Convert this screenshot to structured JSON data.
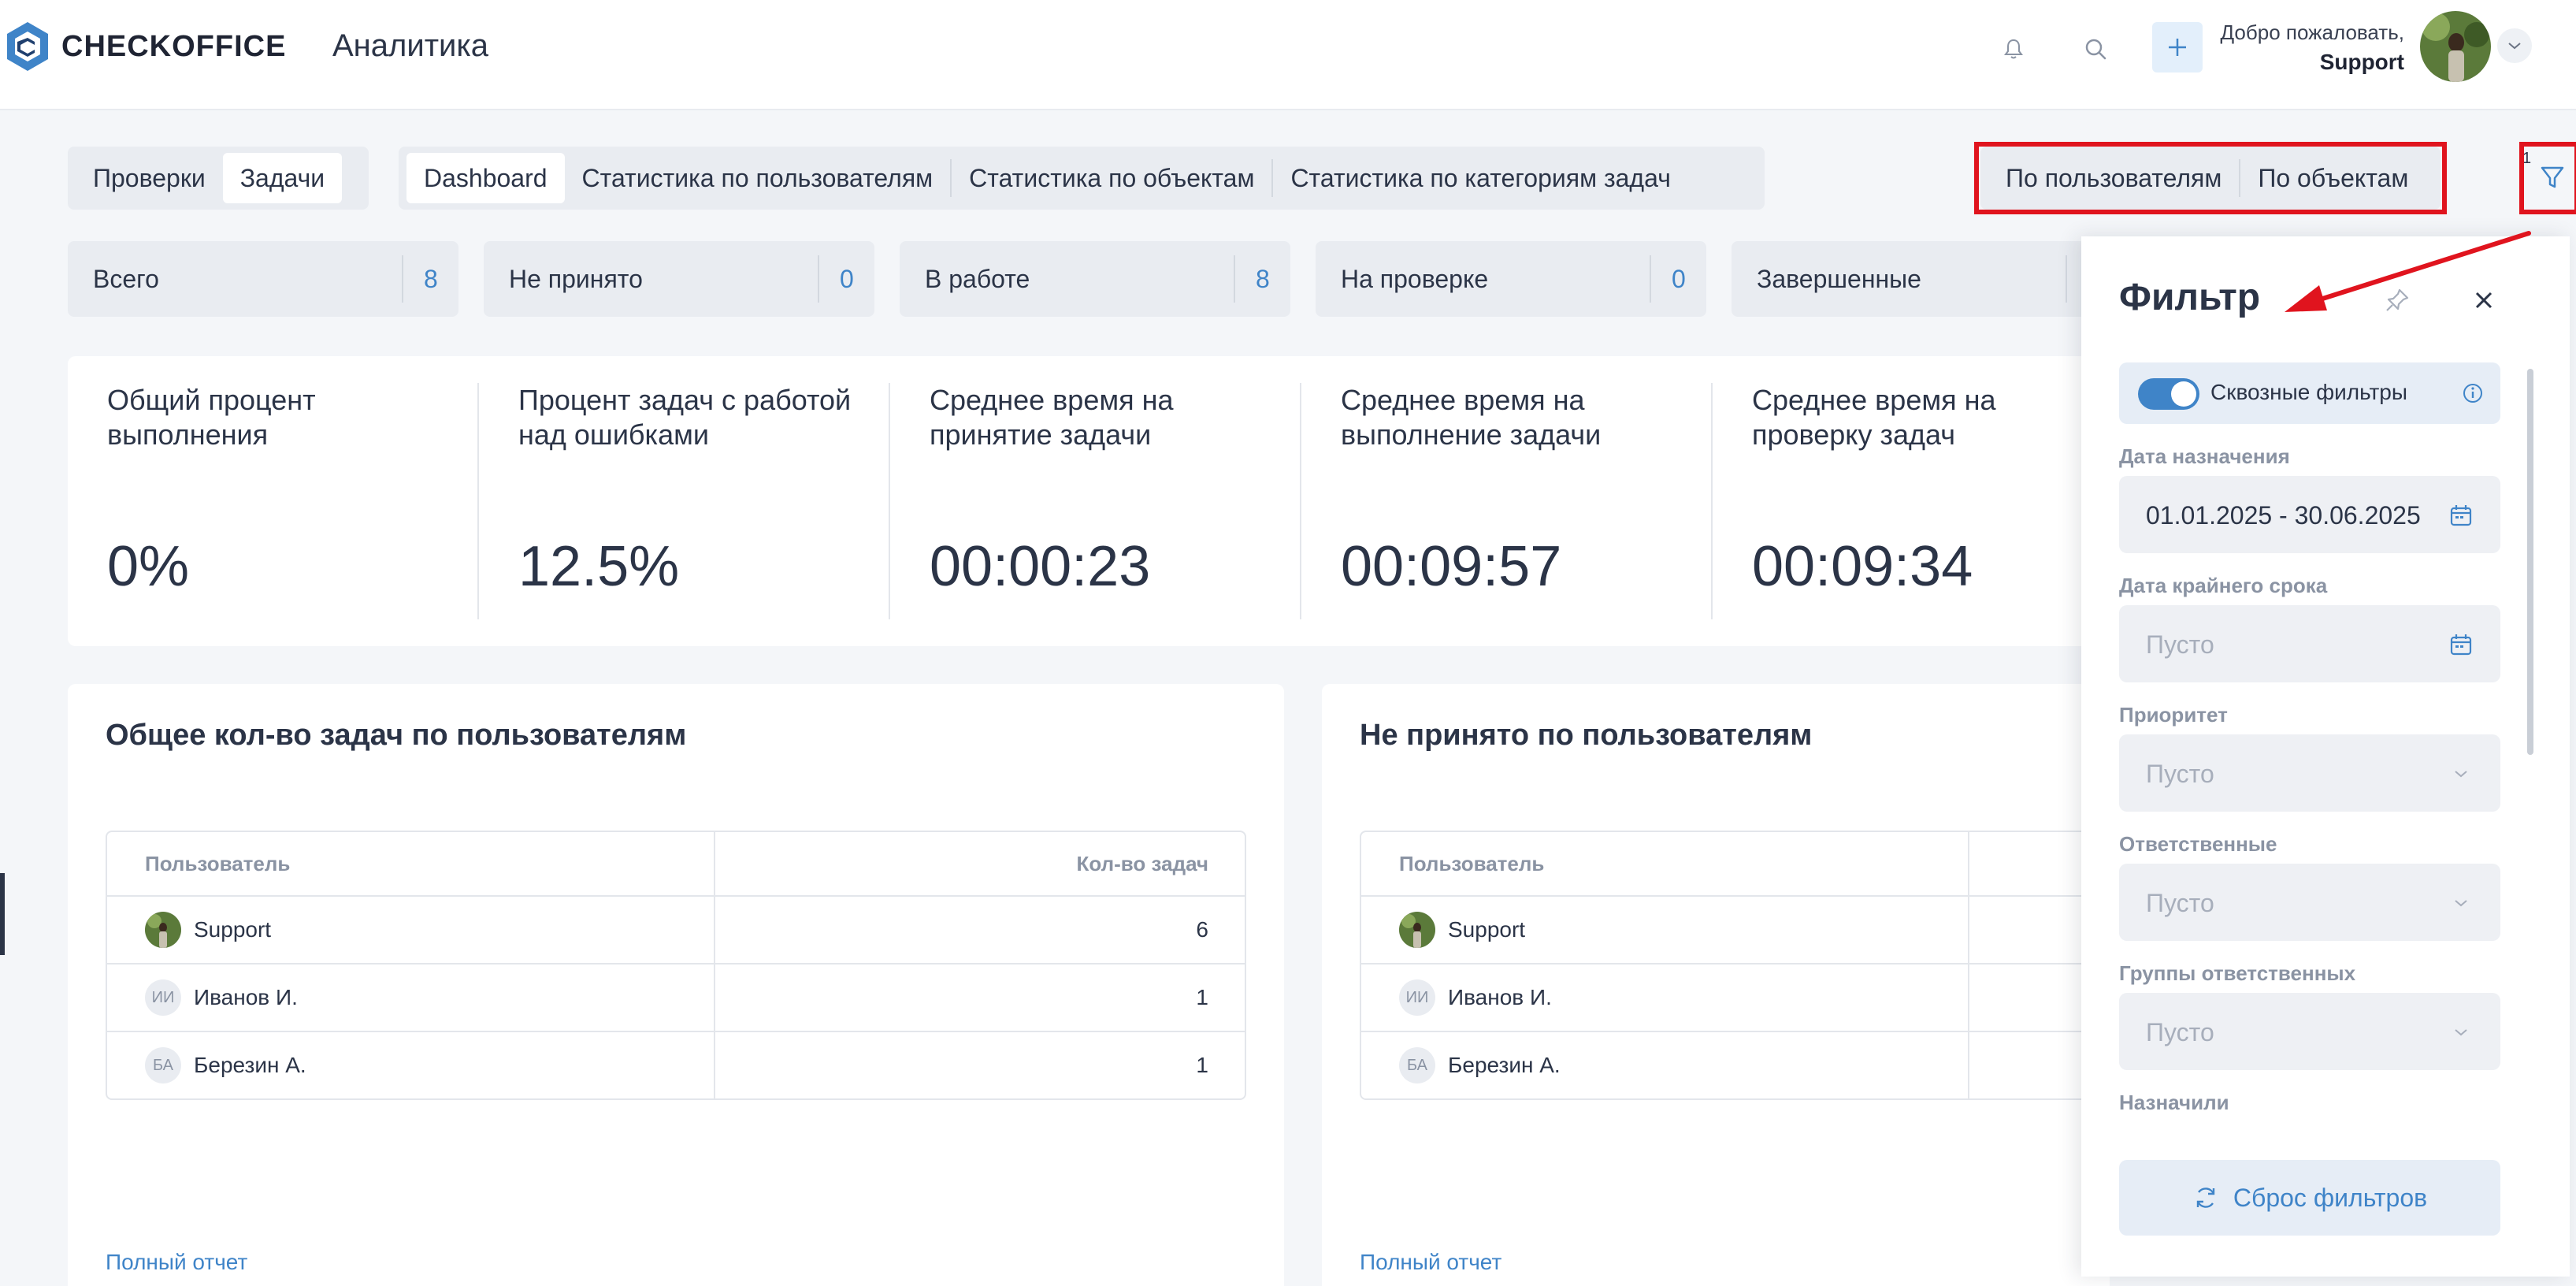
{
  "header": {
    "brand": "CHECKOFFICE",
    "page_title": "Аналитика",
    "welcome": "Добро пожаловать,",
    "user": "Support"
  },
  "tabs": {
    "group1": [
      {
        "label": "Проверки"
      },
      {
        "label": "Задачи",
        "active": true
      }
    ],
    "group2": [
      {
        "label": "Dashboard",
        "active": true
      },
      {
        "label": "Статистика по пользователям"
      },
      {
        "label": "Статистика по объектам"
      },
      {
        "label": "Статистика по категориям задач"
      }
    ],
    "group3": [
      {
        "label": "По пользователям"
      },
      {
        "label": "По объектам"
      }
    ],
    "filter_count": "1"
  },
  "stats": [
    {
      "label": "Всего",
      "value": "8"
    },
    {
      "label": "Не принято",
      "value": "0"
    },
    {
      "label": "В работе",
      "value": "8"
    },
    {
      "label": "На проверке",
      "value": "0"
    },
    {
      "label": "Завершенные",
      "value": ""
    }
  ],
  "metrics": [
    {
      "title": "Общий процент выполнения",
      "value": "0%"
    },
    {
      "title": "Процент задач с работой над ошибками",
      "value": "12.5%"
    },
    {
      "title": "Среднее время на принятие задачи",
      "value": "00:00:23"
    },
    {
      "title": "Среднее время на выполнение задачи",
      "value": "00:09:57"
    },
    {
      "title": "Среднее время на проверку задач",
      "value": "00:09:34"
    }
  ],
  "card_left": {
    "title": "Общее кол-во задач по пользователям",
    "col_user": "Пользователь",
    "col_count": "Кол-во задач",
    "rows": [
      {
        "initials": "",
        "name": "Support",
        "count": "6"
      },
      {
        "initials": "ИИ",
        "name": "Иванов И.",
        "count": "1"
      },
      {
        "initials": "БА",
        "name": "Березин А.",
        "count": "1"
      }
    ],
    "link": "Полный отчет"
  },
  "card_right": {
    "title": "Не принято по пользователям",
    "col_user": "Пользователь",
    "rows": [
      {
        "initials": "",
        "name": "Support"
      },
      {
        "initials": "ИИ",
        "name": "Иванов И."
      },
      {
        "initials": "БА",
        "name": "Березин А."
      }
    ],
    "link": "Полный отчет"
  },
  "filter_panel": {
    "title": "Фильтр",
    "toggle_label": "Сквозные фильтры",
    "toggle_on": true,
    "fields": [
      {
        "label": "Дата назначения",
        "value": "01.01.2025 - 30.06.2025",
        "icon": "calendar-icon"
      },
      {
        "label": "Дата крайнего срока",
        "placeholder": "Пусто",
        "icon": "calendar-icon"
      },
      {
        "label": "Приоритет",
        "placeholder": "Пусто",
        "icon": "chevron-down-icon"
      },
      {
        "label": "Ответственные",
        "placeholder": "Пусто",
        "icon": "chevron-down-icon"
      },
      {
        "label": "Группы ответственных",
        "placeholder": "Пусто",
        "icon": "chevron-down-icon"
      },
      {
        "label": "Назначили"
      }
    ],
    "reset_label": "Сброс фильтров"
  },
  "colors": {
    "accent": "#3f84c8",
    "highlight": "#e0141e",
    "text": "#2b3447"
  }
}
